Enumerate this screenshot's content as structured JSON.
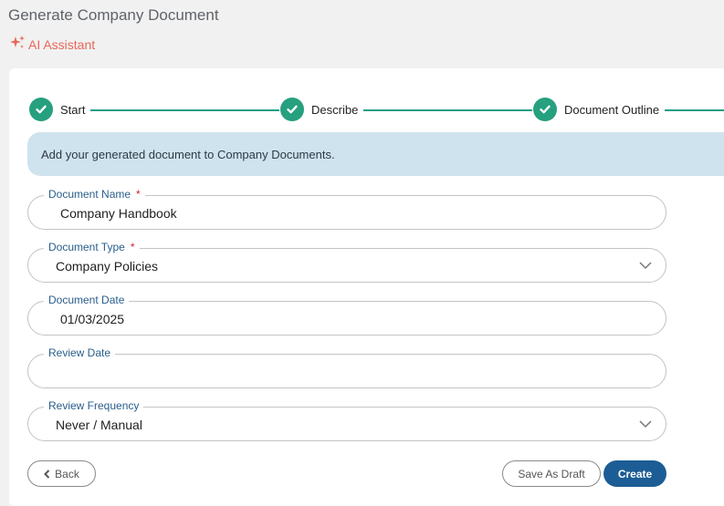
{
  "header": {
    "title": "Generate Company Document",
    "ai_assistant_label": "AI Assistant"
  },
  "stepper": {
    "steps": [
      {
        "label": "Start",
        "status": "complete"
      },
      {
        "label": "Describe",
        "status": "complete"
      },
      {
        "label": "Document Outline",
        "status": "complete"
      }
    ]
  },
  "banner": {
    "text": "Add your generated document to Company Documents."
  },
  "form": {
    "document_name": {
      "label": "Document Name",
      "required_mark": "*",
      "value": "Company Handbook"
    },
    "document_type": {
      "label": "Document Type",
      "required_mark": "*",
      "value": "Company Policies"
    },
    "document_date": {
      "label": "Document Date",
      "value": "01/03/2025"
    },
    "review_date": {
      "label": "Review Date",
      "value": ""
    },
    "review_frequency": {
      "label": "Review Frequency",
      "value": "Never / Manual"
    }
  },
  "actions": {
    "back_label": "Back",
    "save_draft_label": "Save As Draft",
    "create_label": "Create"
  },
  "colors": {
    "accent_green": "#26a07f",
    "primary_blue": "#1d5d95",
    "ai_coral": "#e8675a",
    "banner_bg": "#cfe3ee",
    "label_blue": "#2a5e8c"
  },
  "icons": {
    "ai": "sparkle-icon",
    "step": "check-icon",
    "select": "chevron-down-icon",
    "back": "chevron-left-icon"
  }
}
